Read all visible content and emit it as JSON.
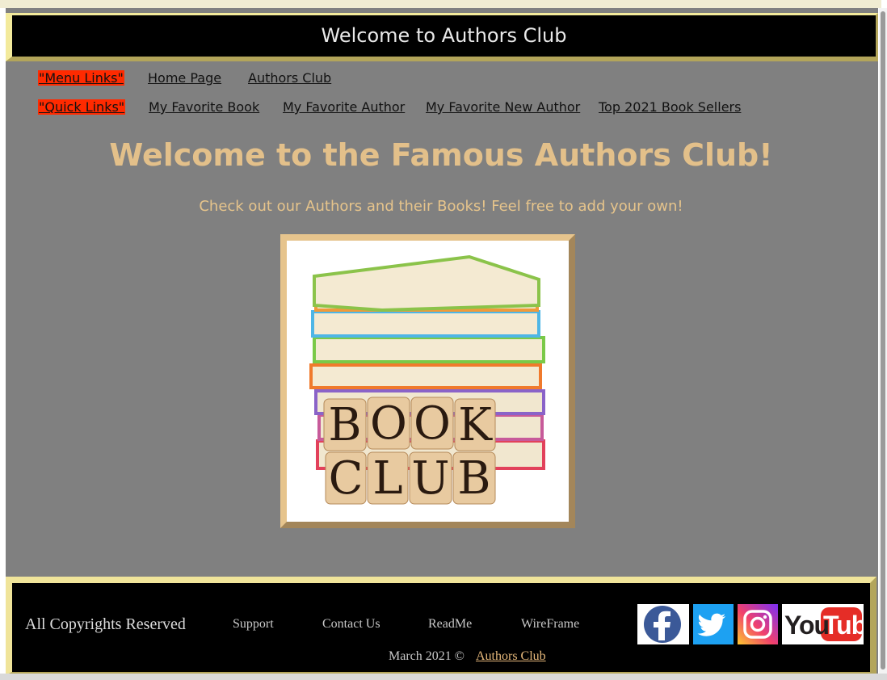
{
  "header": {
    "title": "Welcome to Authors Club"
  },
  "nav": {
    "menu_label": "\"Menu Links\"",
    "menu_links": [
      "Home Page",
      "Authors Club"
    ],
    "quick_label": "\"Quick Links\"",
    "quick_links": [
      "My Favorite Book",
      "My Favorite Author",
      "My Favorite New Author",
      "Top 2021 Book Sellers"
    ]
  },
  "main": {
    "title": "Welcome to the Famous Authors Club!",
    "subtitle": "Check out our Authors and their Books! Feel free to add your own!",
    "image_letters": [
      "B",
      "O",
      "O",
      "K",
      "C",
      "L",
      "U",
      "B"
    ]
  },
  "footer": {
    "copyright": "All Copyrights Reserved",
    "links": [
      "Support",
      "Contact Us",
      "ReadMe",
      "WireFrame"
    ],
    "date": "March 2021 ©",
    "club_link": "Authors Club",
    "social": [
      "facebook-icon",
      "twitter-icon",
      "instagram-icon",
      "youtube-icon"
    ],
    "youtube_text": "You Tube"
  },
  "colors": {
    "page_bg": "#808080",
    "header_bg": "#000000",
    "hero_text": "#e3c08a",
    "highlight": "#ff2a00",
    "footer_link": "#e6b87a"
  }
}
